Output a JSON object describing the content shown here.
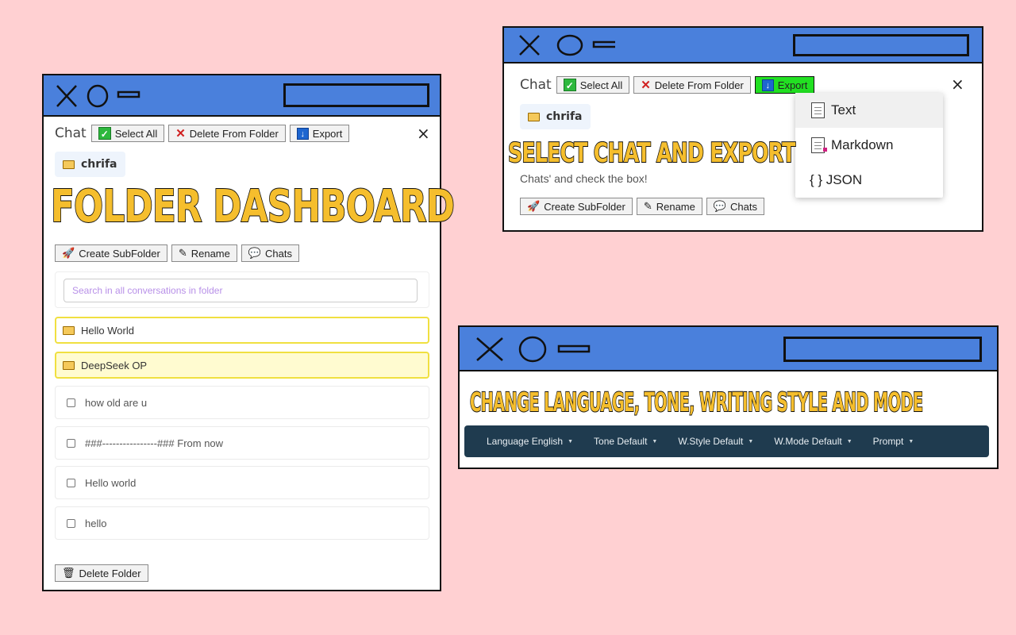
{
  "colors": {
    "background": "#ffd0d2",
    "window_bar": "#4a80dc",
    "overlay_text": "#f5be2d",
    "export_active": "#22e022",
    "folder_border": "#f0e040",
    "lang_bar": "#1f3b4f"
  },
  "panel1": {
    "overlay_title": "FOLDER DASHBOARD",
    "header": {
      "chat_label": "Chat",
      "select_all": "Select All",
      "delete_from_folder": "Delete From Folder",
      "export": "Export",
      "close": "×"
    },
    "folder_chip": "chrifa",
    "actions": {
      "create_subfolder": "Create SubFolder",
      "rename": "Rename",
      "chats": "Chats"
    },
    "search": {
      "placeholder": "Search in all conversations in folder"
    },
    "folders": [
      {
        "label": "Hello World"
      },
      {
        "label": "DeepSeek OP"
      }
    ],
    "chats": [
      {
        "label": "how old are u"
      },
      {
        "label": "###----------------### From now"
      },
      {
        "label": "Hello world"
      },
      {
        "label": "hello"
      }
    ],
    "delete_folder": "Delete Folder"
  },
  "panel2": {
    "overlay_title": "SELECT CHAT AND EXPORT",
    "header": {
      "chat_label": "Chat",
      "select_all": "Select All",
      "delete_from_folder": "Delete From Folder",
      "export": "Export",
      "close": "×"
    },
    "folder_chip": "chrifa",
    "desc_line": "Chats' and check the box!",
    "export_menu": [
      {
        "label": "Text"
      },
      {
        "label": "Markdown"
      },
      {
        "label": "{ } JSON"
      }
    ],
    "actions": {
      "create_subfolder": "Create SubFolder",
      "rename": "Rename",
      "chats": "Chats"
    }
  },
  "panel3": {
    "overlay_title": "CHANGE LANGUAGE, TONE, WRITING STYLE AND MODE",
    "toolbar": [
      {
        "label": "Language English"
      },
      {
        "label": "Tone Default"
      },
      {
        "label": "W.Style Default"
      },
      {
        "label": "W.Mode Default"
      },
      {
        "label": "Prompt"
      }
    ]
  }
}
